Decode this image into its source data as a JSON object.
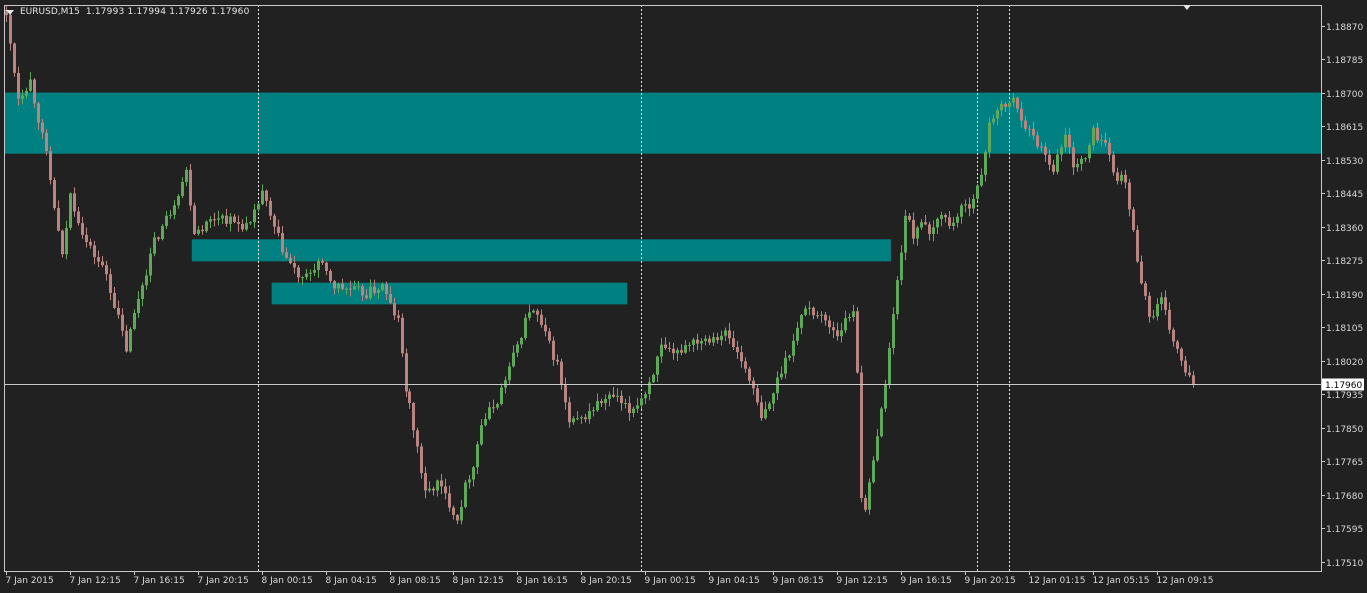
{
  "header": {
    "symbol": "EURUSD,M15",
    "ohlc": "1.17993 1.17994 1.17926 1.17960"
  },
  "colors": {
    "background": "#212121",
    "frame": "#c8c8c8",
    "bull_candle": "#5fa85a",
    "bear_candle": "#b9837f",
    "zone": "#008080",
    "separator": "#e6e6e6",
    "price_line": "#c8c8c8",
    "price_tag_bg": "#ffffff",
    "price_tag_text": "#000000"
  },
  "chart_data": {
    "type": "candlestick",
    "symbol": "EURUSD",
    "timeframe": "M15",
    "current_price": 1.1796,
    "y_ticks": [
      "1.18870",
      "1.18785",
      "1.18700",
      "1.18615",
      "1.18530",
      "1.18445",
      "1.18360",
      "1.18275",
      "1.18190",
      "1.18105",
      "1.18020",
      "1.17935",
      "1.17850",
      "1.17765",
      "1.17680",
      "1.17595",
      "1.17510"
    ],
    "ylim": [
      1.17487,
      1.18922
    ],
    "x_ticks": [
      {
        "bar": 0,
        "label": "7 Jan 2015"
      },
      {
        "bar": 16,
        "label": "7 Jan 12:15"
      },
      {
        "bar": 32,
        "label": "7 Jan 16:15"
      },
      {
        "bar": 48,
        "label": "7 Jan 20:15"
      },
      {
        "bar": 64,
        "label": "8 Jan 00:15"
      },
      {
        "bar": 80,
        "label": "8 Jan 04:15"
      },
      {
        "bar": 96,
        "label": "8 Jan 08:15"
      },
      {
        "bar": 112,
        "label": "8 Jan 12:15"
      },
      {
        "bar": 128,
        "label": "8 Jan 16:15"
      },
      {
        "bar": 144,
        "label": "8 Jan 20:15"
      },
      {
        "bar": 160,
        "label": "9 Jan 00:15"
      },
      {
        "bar": 176,
        "label": "9 Jan 04:15"
      },
      {
        "bar": 192,
        "label": "9 Jan 08:15"
      },
      {
        "bar": 208,
        "label": "9 Jan 12:15"
      },
      {
        "bar": 224,
        "label": "9 Jan 16:15"
      },
      {
        "bar": 240,
        "label": "9 Jan 20:15"
      },
      {
        "bar": 256,
        "label": "12 Jan 01:15"
      },
      {
        "bar": 272,
        "label": "12 Jan 05:15"
      },
      {
        "bar": 288,
        "label": "12 Jan 09:15"
      }
    ],
    "day_separators_bar": [
      63,
      159,
      243,
      251
    ],
    "zones": [
      {
        "bar_start": 0,
        "bar_end": 329,
        "price_top": 1.187,
        "price_bottom": 1.18545
      },
      {
        "bar_start": 47,
        "bar_end": 221,
        "price_top": 1.18328,
        "price_bottom": 1.18272
      },
      {
        "bar_start": 67,
        "bar_end": 155,
        "price_top": 1.18218,
        "price_bottom": 1.18163
      }
    ],
    "path": [
      [
        0,
        1.1889
      ],
      [
        3,
        1.1869
      ],
      [
        6,
        1.1873
      ],
      [
        10,
        1.1854
      ],
      [
        14,
        1.1828
      ],
      [
        16,
        1.1844
      ],
      [
        20,
        1.1832
      ],
      [
        25,
        1.1824
      ],
      [
        30,
        1.1805
      ],
      [
        33,
        1.1818
      ],
      [
        37,
        1.1832
      ],
      [
        41,
        1.184
      ],
      [
        45,
        1.185
      ],
      [
        47,
        1.1835
      ],
      [
        49,
        1.1836
      ],
      [
        53,
        1.1839
      ],
      [
        57,
        1.1837
      ],
      [
        61,
        1.1836
      ],
      [
        64,
        1.1845
      ],
      [
        66,
        1.1838
      ],
      [
        70,
        1.1828
      ],
      [
        74,
        1.1822
      ],
      [
        78,
        1.1827
      ],
      [
        82,
        1.1821
      ],
      [
        86,
        1.182
      ],
      [
        90,
        1.1819
      ],
      [
        94,
        1.1821
      ],
      [
        96,
        1.1816
      ],
      [
        98,
        1.1812
      ],
      [
        100,
        1.1795
      ],
      [
        103,
        1.178
      ],
      [
        105,
        1.1768
      ],
      [
        108,
        1.1771
      ],
      [
        111,
        1.1766
      ],
      [
        113,
        1.1762
      ],
      [
        115,
        1.177
      ],
      [
        117,
        1.1776
      ],
      [
        119,
        1.1786
      ],
      [
        123,
        1.1792
      ],
      [
        127,
        1.1803
      ],
      [
        131,
        1.1815
      ],
      [
        133,
        1.1813
      ],
      [
        136,
        1.1806
      ],
      [
        138,
        1.1801
      ],
      [
        141,
        1.1786
      ],
      [
        144,
        1.1787
      ],
      [
        148,
        1.1791
      ],
      [
        152,
        1.1793
      ],
      [
        156,
        1.1789
      ],
      [
        160,
        1.1794
      ],
      [
        164,
        1.1805
      ],
      [
        167,
        1.1803
      ],
      [
        171,
        1.1807
      ],
      [
        176,
        1.1808
      ],
      [
        180,
        1.1809
      ],
      [
        183,
        1.1804
      ],
      [
        186,
        1.1798
      ],
      [
        189,
        1.1787
      ],
      [
        191,
        1.1791
      ],
      [
        194,
        1.18
      ],
      [
        197,
        1.1807
      ],
      [
        200,
        1.1816
      ],
      [
        204,
        1.1813
      ],
      [
        208,
        1.1809
      ],
      [
        212,
        1.1815
      ],
      [
        213,
        1.18
      ],
      [
        214,
        1.1768
      ],
      [
        215,
        1.1763
      ],
      [
        217,
        1.1778
      ],
      [
        219,
        1.1789
      ],
      [
        221,
        1.1805
      ],
      [
        223,
        1.1822
      ],
      [
        225,
        1.1839
      ],
      [
        227,
        1.1834
      ],
      [
        229,
        1.1838
      ],
      [
        231,
        1.1833
      ],
      [
        234,
        1.184
      ],
      [
        236,
        1.1836
      ],
      [
        238,
        1.1839
      ],
      [
        241,
        1.1842
      ],
      [
        244,
        1.1848
      ],
      [
        246,
        1.1863
      ],
      [
        249,
        1.1866
      ],
      [
        252,
        1.1868
      ],
      [
        254,
        1.1864
      ],
      [
        256,
        1.186
      ],
      [
        259,
        1.1856
      ],
      [
        262,
        1.1851
      ],
      [
        265,
        1.1859
      ],
      [
        267,
        1.1852
      ],
      [
        270,
        1.1853
      ],
      [
        272,
        1.186
      ],
      [
        275,
        1.1857
      ],
      [
        277,
        1.185
      ],
      [
        280,
        1.1847
      ],
      [
        283,
        1.1828
      ],
      [
        286,
        1.1813
      ],
      [
        289,
        1.1817
      ],
      [
        292,
        1.1807
      ],
      [
        295,
        1.1799
      ],
      [
        297,
        1.1796
      ]
    ]
  }
}
